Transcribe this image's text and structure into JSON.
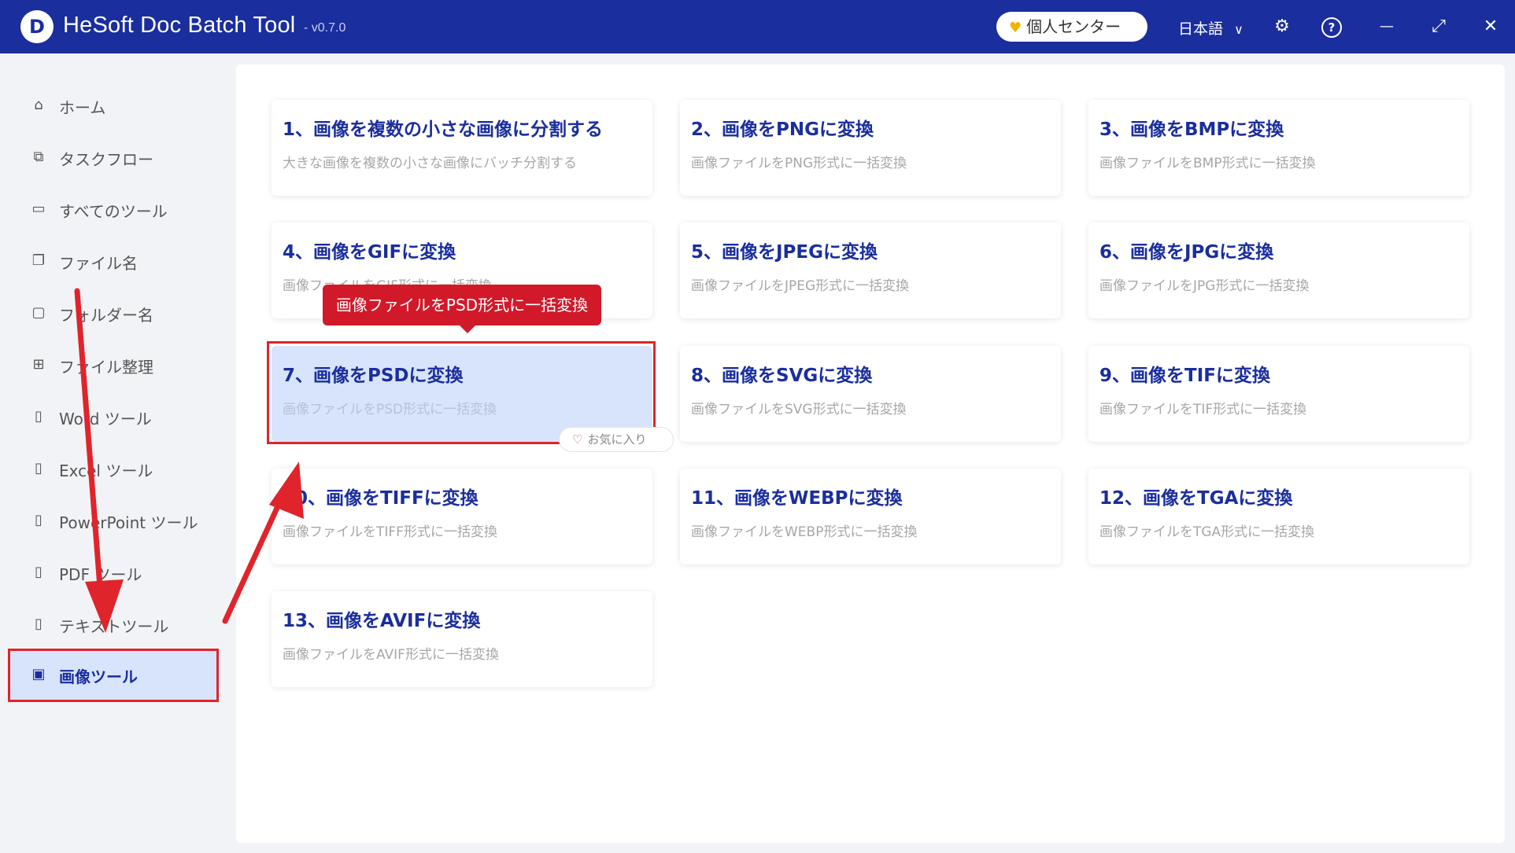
{
  "titlebar": {
    "logo_letter": "D",
    "app_title": "HeSoft Doc Batch Tool",
    "version": "- v0.7.0",
    "user_center_label": "個人センター",
    "language": "日本語",
    "language_chevron": "∨",
    "settings_glyph": "⚙",
    "help_glyph": "?",
    "minimize_glyph": "—",
    "maximize_glyph": "⤢",
    "close_glyph": "✕"
  },
  "sidebar": {
    "items": [
      {
        "label": "ホーム",
        "icon": "home-icon",
        "glyph": "⌂"
      },
      {
        "label": "タスクフロー",
        "icon": "flow-icon",
        "glyph": "⧉"
      },
      {
        "label": "すべてのツール",
        "icon": "monitor-icon",
        "glyph": "▭"
      },
      {
        "label": "ファイル名",
        "icon": "file-copy-icon",
        "glyph": "❐"
      },
      {
        "label": "フォルダー名",
        "icon": "folder-icon",
        "glyph": "▢"
      },
      {
        "label": "ファイル整理",
        "icon": "organize-icon",
        "glyph": "⊞"
      },
      {
        "label": "Word ツール",
        "icon": "word-icon",
        "glyph": "▯"
      },
      {
        "label": "Excel ツール",
        "icon": "excel-icon",
        "glyph": "▯"
      },
      {
        "label": "PowerPoint ツール",
        "icon": "powerpoint-icon",
        "glyph": "▯"
      },
      {
        "label": "PDF ツール",
        "icon": "pdf-icon",
        "glyph": "▯"
      },
      {
        "label": "テキストツール",
        "icon": "text-file-icon",
        "glyph": "▯"
      },
      {
        "label": "画像ツール",
        "icon": "image-icon",
        "glyph": "▣"
      }
    ],
    "active_index": 11
  },
  "cards": [
    {
      "title": "1、画像を複数の小さな画像に分割する",
      "desc": "大きな画像を複数の小さな画像にバッチ分割する"
    },
    {
      "title": "2、画像をPNGに変換",
      "desc": "画像ファイルをPNG形式に一括変換"
    },
    {
      "title": "3、画像をBMPに変換",
      "desc": "画像ファイルをBMP形式に一括変換"
    },
    {
      "title": "4、画像をGIFに変換",
      "desc": "画像ファイルをGIF形式に一括変換"
    },
    {
      "title": "5、画像をJPEGに変換",
      "desc": "画像ファイルをJPEG形式に一括変換"
    },
    {
      "title": "6、画像をJPGに変換",
      "desc": "画像ファイルをJPG形式に一括変換"
    },
    {
      "title": "7、画像をPSDに変換",
      "desc": "画像ファイルをPSD形式に一括変換"
    },
    {
      "title": "8、画像をSVGに変換",
      "desc": "画像ファイルをSVG形式に一括変換"
    },
    {
      "title": "9、画像をTIFに変換",
      "desc": "画像ファイルをTIF形式に一括変換"
    },
    {
      "title": "10、画像をTIFFに変換",
      "desc": "画像ファイルをTIFF形式に一括変換"
    },
    {
      "title": "11、画像をWEBPに変換",
      "desc": "画像ファイルをWEBP形式に一括変換"
    },
    {
      "title": "12、画像をTGAに変換",
      "desc": "画像ファイルをTGA形式に一括変換"
    },
    {
      "title": "13、画像をAVIFに変換",
      "desc": "画像ファイルをAVIF形式に一括変換"
    }
  ],
  "highlighted_card_index": 6,
  "tooltip_text": "画像ファイルをPSD形式に一括変換",
  "favorite_label": "お気に入り",
  "favorite_glyph": "♡",
  "colors": {
    "titlebar": "#1a2e9e",
    "accent": "#1a2e9e",
    "highlight_bg": "#d7e4fb",
    "annotation_red": "#e0242b"
  }
}
